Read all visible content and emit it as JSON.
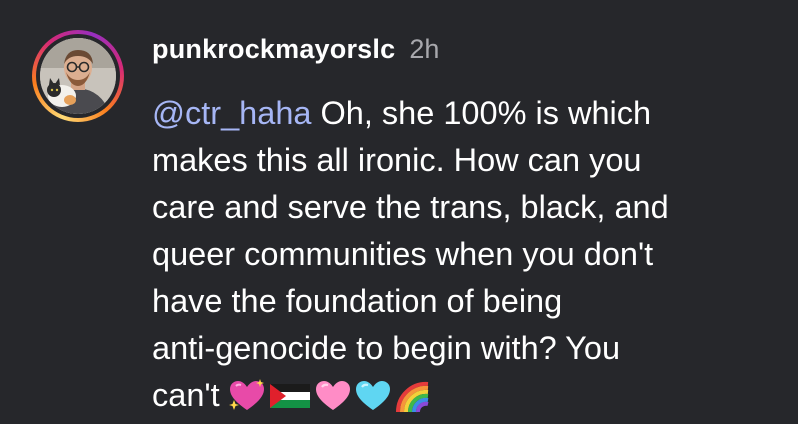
{
  "comment": {
    "author": {
      "username": "punkrockmayorslc",
      "timestamp": "2h",
      "avatar": "profile-photo"
    },
    "mention": "@ctr_haha",
    "lines": [
      " Oh, she 100% is which",
      "makes this all ironic. How can you",
      "care and serve the trans, black, and",
      "queer communities when you don't",
      "have the foundation of being",
      "anti-genocide to begin with? You",
      "can't"
    ],
    "emojis": [
      "sparkling-heart-icon",
      "palestine-flag-icon",
      "pink-heart-icon",
      "light-blue-heart-icon",
      "rainbow-icon"
    ]
  },
  "colors": {
    "background": "#26272b",
    "mention": "#a6b6f5",
    "text": "#ffffff",
    "muted": "#a8a8ad"
  }
}
